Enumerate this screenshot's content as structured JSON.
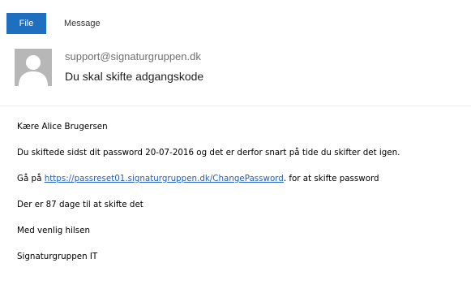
{
  "ribbon": {
    "tabs": [
      {
        "label": "File"
      },
      {
        "label": "Message"
      }
    ]
  },
  "header": {
    "sender": "support@signaturgruppen.dk",
    "subject": "Du skal skifte adgangskode"
  },
  "body": {
    "greeting": "Kære Alice Brugersen",
    "paragraph1": "Du skiftede sidst dit password 20-07-2016 og det er derfor snart på tide du skifter det igen.",
    "paragraph2_prefix": "Gå på ",
    "paragraph2_link": "https://passreset01.signaturgruppen.dk/ChangePassword",
    "paragraph2_suffix": ".  for at skifte password",
    "paragraph3": "Der er 87 dage til at skifte det",
    "closing": "Med venlig hilsen",
    "signature": "Signaturgruppen  IT"
  },
  "colors": {
    "file_tab_bg": "#1f6fc1",
    "link": "#1f5fc2",
    "avatar_bg": "#b7b7b7"
  },
  "icons": {
    "avatar": "person-silhouette-icon"
  }
}
